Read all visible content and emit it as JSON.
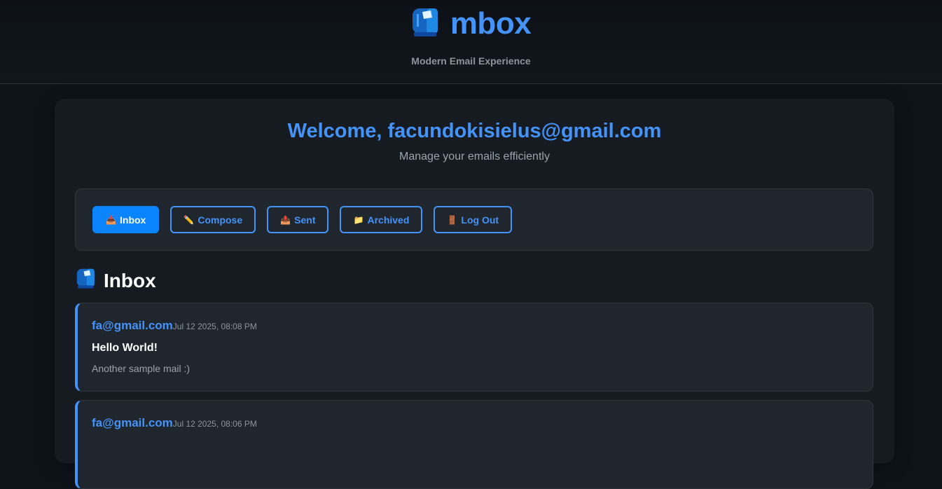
{
  "header": {
    "title": "mbox",
    "tagline": "Modern Email Experience"
  },
  "main": {
    "welcome": "Welcome, facundokisielus@gmail.com",
    "subtitle": "Manage your emails efficiently"
  },
  "nav": {
    "buttons": [
      {
        "label": "Inbox",
        "icon": "📥",
        "icon_name": "inbox-tray-icon",
        "active": true
      },
      {
        "label": "Compose",
        "icon": "✏️",
        "icon_name": "pencil-icon",
        "active": false
      },
      {
        "label": "Sent",
        "icon": "📤",
        "icon_name": "outbox-tray-icon",
        "active": false
      },
      {
        "label": "Archived",
        "icon": "📁",
        "icon_name": "folder-icon",
        "active": false
      },
      {
        "label": "Log Out",
        "icon": "🚪",
        "icon_name": "door-icon",
        "active": false
      }
    ]
  },
  "inbox": {
    "heading": "Inbox",
    "emails": [
      {
        "from": "fa@gmail.com",
        "date": "Jul 12 2025, 08:08 PM",
        "subject": "Hello World!",
        "preview": "Another sample mail :)"
      },
      {
        "from": "fa@gmail.com",
        "date": "Jul 12 2025, 08:06 PM",
        "subject": "",
        "preview": ""
      }
    ]
  },
  "colors": {
    "accent": "#4493f8",
    "active_button": "#0a84ff",
    "background": "#0e131a",
    "card": "#161b22",
    "panel": "#20262e"
  }
}
